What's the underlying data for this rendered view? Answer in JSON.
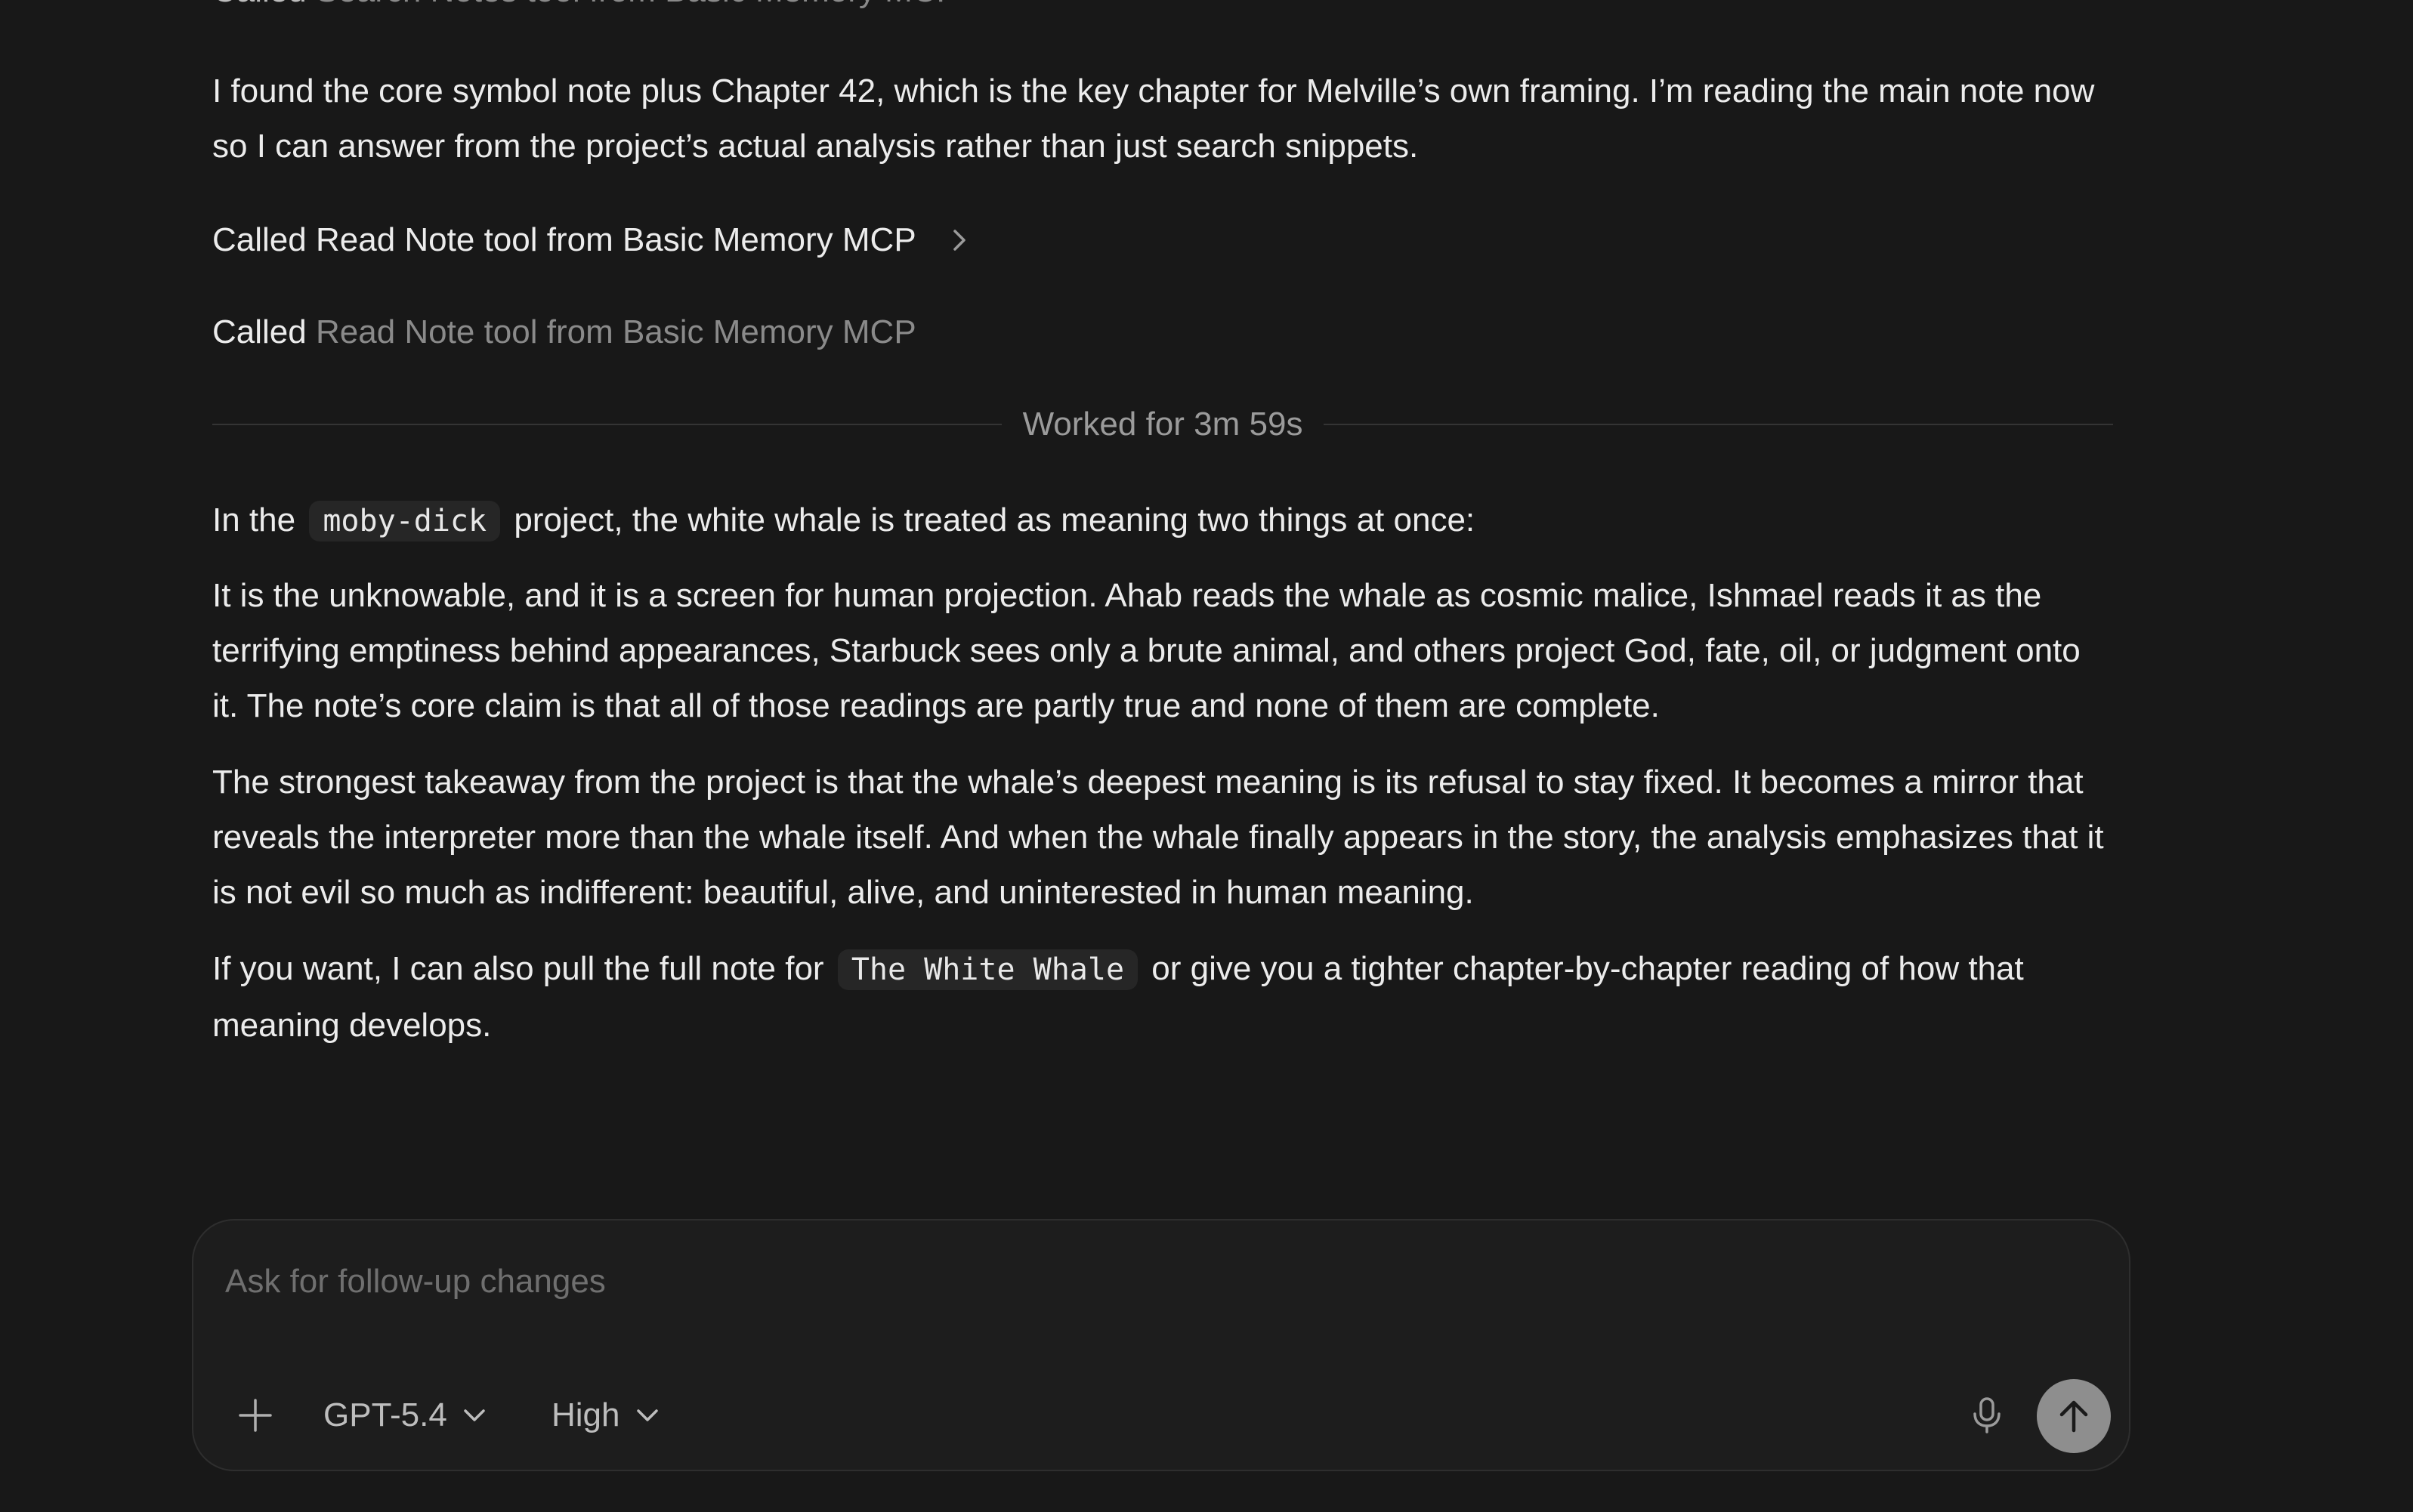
{
  "thread": {
    "faded_tool_call": {
      "verb": "Called",
      "description": "Search Notes tool from Basic Memory MCP"
    },
    "intro_paragraph": "I found the core symbol note plus Chapter 42, which is the key chapter for Melville’s own framing. I’m reading the main note now so I can answer from the project’s actual analysis rather than just search snippets.",
    "tool_calls": [
      {
        "verb": "Called",
        "description": "Read Note tool from Basic Memory MCP"
      },
      {
        "verb": "Called",
        "description": "Read Note tool from Basic Memory MCP"
      }
    ],
    "worked_label": "Worked for 3m 59s",
    "answer": {
      "p1_before": "In the",
      "p1_code": "moby-dick",
      "p1_after": "project, the white whale is treated as meaning two things at once:",
      "p2": "It is the unknowable, and it is a screen for human projection. Ahab reads the whale as cosmic malice, Ishmael reads it as the terrifying emptiness behind appearances, Starbuck sees only a brute animal, and others project God, fate, oil, or judgment onto it. The note’s core claim is that all of those readings are partly true and none of them are complete.",
      "p3": "The strongest takeaway from the project is that the whale’s deepest meaning is its refusal to stay fixed. It becomes a mirror that reveals the interpreter more than the whale itself. And when the whale finally appears in the story, the analysis emphasizes that it is not evil so much as indifferent: beautiful, alive, and uninterested in human meaning.",
      "p4_before": "If you want, I can also pull the full note for",
      "p4_code": "The White Whale",
      "p4_after": "or give you a tighter chapter-by-chapter reading of how that meaning develops."
    }
  },
  "composer": {
    "placeholder": "Ask for follow-up changes",
    "value": "",
    "model": "GPT-5.4",
    "effort": "High",
    "icons": {
      "add": "plus-icon",
      "model_dropdown": "chevron-down-icon",
      "effort_dropdown": "chevron-down-icon",
      "voice": "microphone-icon",
      "send": "arrow-up-icon"
    }
  },
  "colors": {
    "background": "#181818",
    "text": "#ececec",
    "muted_text": "#8a8a8a",
    "composer_border": "#2e2e2e",
    "send_button": "#8e8e8e"
  }
}
